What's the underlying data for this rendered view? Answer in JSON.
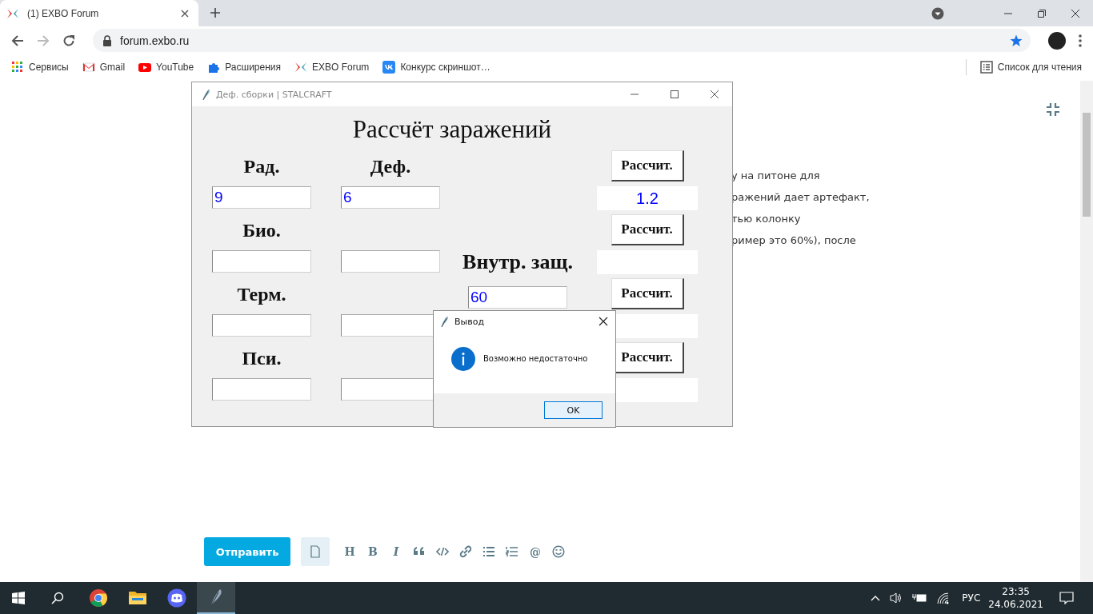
{
  "browser": {
    "tabs": [
      {
        "title": "(1) EXBO Forum",
        "selected": true
      }
    ],
    "url": "forum.exbo.ru",
    "bookmarks": [
      {
        "kind": "apps",
        "label": "Сервисы"
      },
      {
        "kind": "mail",
        "label": "Gmail"
      },
      {
        "kind": "video",
        "label": "YouTube"
      },
      {
        "kind": "puzzle",
        "label": "Расширения"
      },
      {
        "kind": "exbo",
        "label": "EXBO Forum"
      },
      {
        "kind": "vk",
        "label": "Конкурс скриншот…"
      }
    ],
    "reading_list": "Список для чтения"
  },
  "forum": {
    "post_lines": [
      "у на питоне для",
      "ражений дает артефакт,",
      "тью колонку",
      "ример это 60%), после"
    ],
    "send_button": "Отправить",
    "tools": [
      {
        "kind": "file"
      },
      {
        "kind": "text",
        "label": "H"
      },
      {
        "kind": "text",
        "label": "B"
      },
      {
        "kind": "italic",
        "label": "I"
      },
      {
        "kind": "quote"
      },
      {
        "kind": "code"
      },
      {
        "kind": "link"
      },
      {
        "kind": "bullets"
      },
      {
        "kind": "numbers"
      },
      {
        "kind": "text",
        "label": "@"
      },
      {
        "kind": "emoji"
      }
    ]
  },
  "app": {
    "title": "Деф. сборки | STALCRAFT",
    "heading": "Рассчёт заражений",
    "rows": [
      {
        "label": "Рад.",
        "value": "9",
        "def_value": "6",
        "def_label": "Деф.",
        "button": "Рассчит.",
        "result": "1.2"
      },
      {
        "label": "Био.",
        "button": "Рассчит."
      },
      {
        "label": "Терм.",
        "button": "Рассчит."
      },
      {
        "label": "Пси.",
        "button": "Рассчит."
      }
    ],
    "inner": {
      "label": "Внутр. защ.",
      "value": "60"
    }
  },
  "dialog": {
    "title": "Вывод",
    "message": "Возможно недостаточно",
    "button": "OK"
  },
  "taskbar": {
    "apps": [
      {
        "kind": "chrome",
        "active": false
      },
      {
        "kind": "folder",
        "active": false
      },
      {
        "kind": "discord",
        "active": false
      },
      {
        "kind": "feather",
        "active": true
      }
    ],
    "language": "РУС",
    "time": "23:35",
    "date": "24.06.2021"
  }
}
